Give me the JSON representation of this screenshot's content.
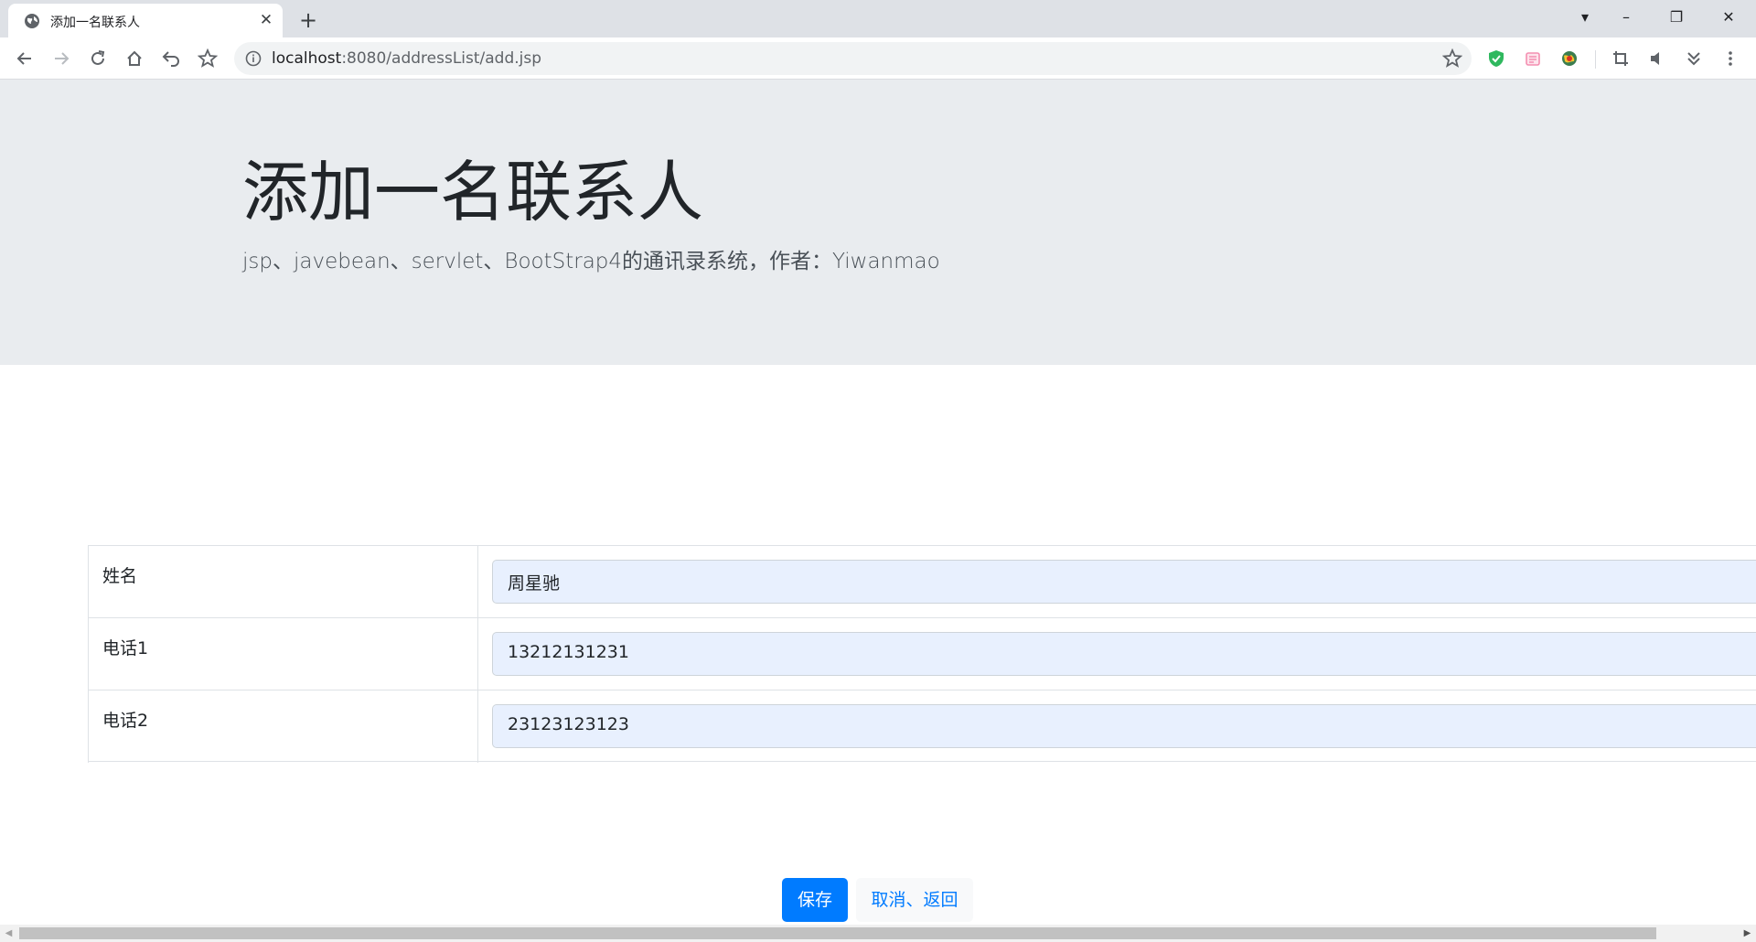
{
  "browser": {
    "tab_title": "添加一名联系人",
    "tab_close": "✕",
    "new_tab": "+",
    "url_host": "localhost",
    "url_rest": ":8080/addressList/add.jsp",
    "window": {
      "minimize": "–",
      "restore": "❐",
      "close": "✕",
      "tab_search": "▾"
    }
  },
  "header": {
    "title": "添加一名联系人",
    "lead": "jsp、javebean、servlet、BootStrap4的通讯录系统，作者：Yiwanmao"
  },
  "form": {
    "rows": [
      {
        "label": "姓名",
        "value": "周星驰"
      },
      {
        "label": "电话1",
        "value": "13212131231"
      },
      {
        "label": "电话2",
        "value": "23123123123"
      }
    ]
  },
  "actions": {
    "save_label": "保存",
    "cancel_label": "取消、返回"
  },
  "colors": {
    "primary": "#007bff",
    "jumbotron_bg": "#e9ecef",
    "autofill_bg": "#e8f0fe"
  }
}
